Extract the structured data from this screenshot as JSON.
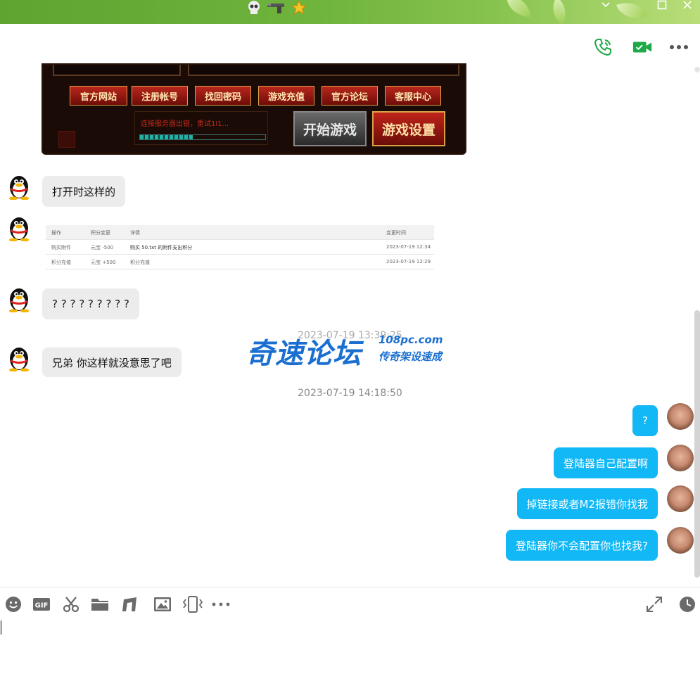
{
  "titlebar": {
    "icons": [
      "skull-icon",
      "gun-icon",
      "star-icon"
    ],
    "controls": [
      "minimize",
      "maximize",
      "close"
    ]
  },
  "header": {
    "actions": [
      "voice-call",
      "video-call",
      "more"
    ]
  },
  "game_screenshot": {
    "buttons": [
      "官方网站",
      "注册帐号",
      "找回密码",
      "游戏充值",
      "官方论坛",
      "客服中心"
    ],
    "status_text": "连接服务器出错，重试1I1...",
    "progress": 0.42,
    "start_button": "开始游戏",
    "settings_button": "游戏设置"
  },
  "messages_left": [
    {
      "text": "打开时这样的"
    },
    {
      "text": "? ? ? ? ? ? ? ? ?"
    },
    {
      "text": "兄弟 你这样就没意思了吧"
    }
  ],
  "table_shot": {
    "headers": [
      "操作",
      "积分变更",
      "详情",
      "变更时间"
    ],
    "rows": [
      [
        "购买附件",
        "元宝 -500",
        "购买 50.txt 的附件支出积分",
        "2023-07-19 12:34"
      ],
      [
        "积分充值",
        "元宝 +500",
        "积分充值",
        "2023-07-19 12:29"
      ]
    ]
  },
  "timestamps": {
    "hidden": "2023-07-19 13:39:25",
    "main": "2023-07-19 14:18:50"
  },
  "watermark": {
    "main": "奇速论坛",
    "url": "108pc.com",
    "sub": "传奇架设速成"
  },
  "messages_right": [
    {
      "text": "?"
    },
    {
      "text": "登陆器自己配置啊"
    },
    {
      "text": "掉链接或者M2报错你找我"
    },
    {
      "text": "登陆器你不会配置你也找我?"
    }
  ],
  "input_toolbar": {
    "tools": [
      "emoji",
      "gif",
      "screenshot",
      "file",
      "music",
      "image",
      "shake",
      "more"
    ],
    "right_tools": [
      "expand",
      "history"
    ]
  },
  "colors": {
    "accent": "#12b7f5",
    "titlebar": "#6fb43c",
    "bubble_left": "#ececec"
  }
}
